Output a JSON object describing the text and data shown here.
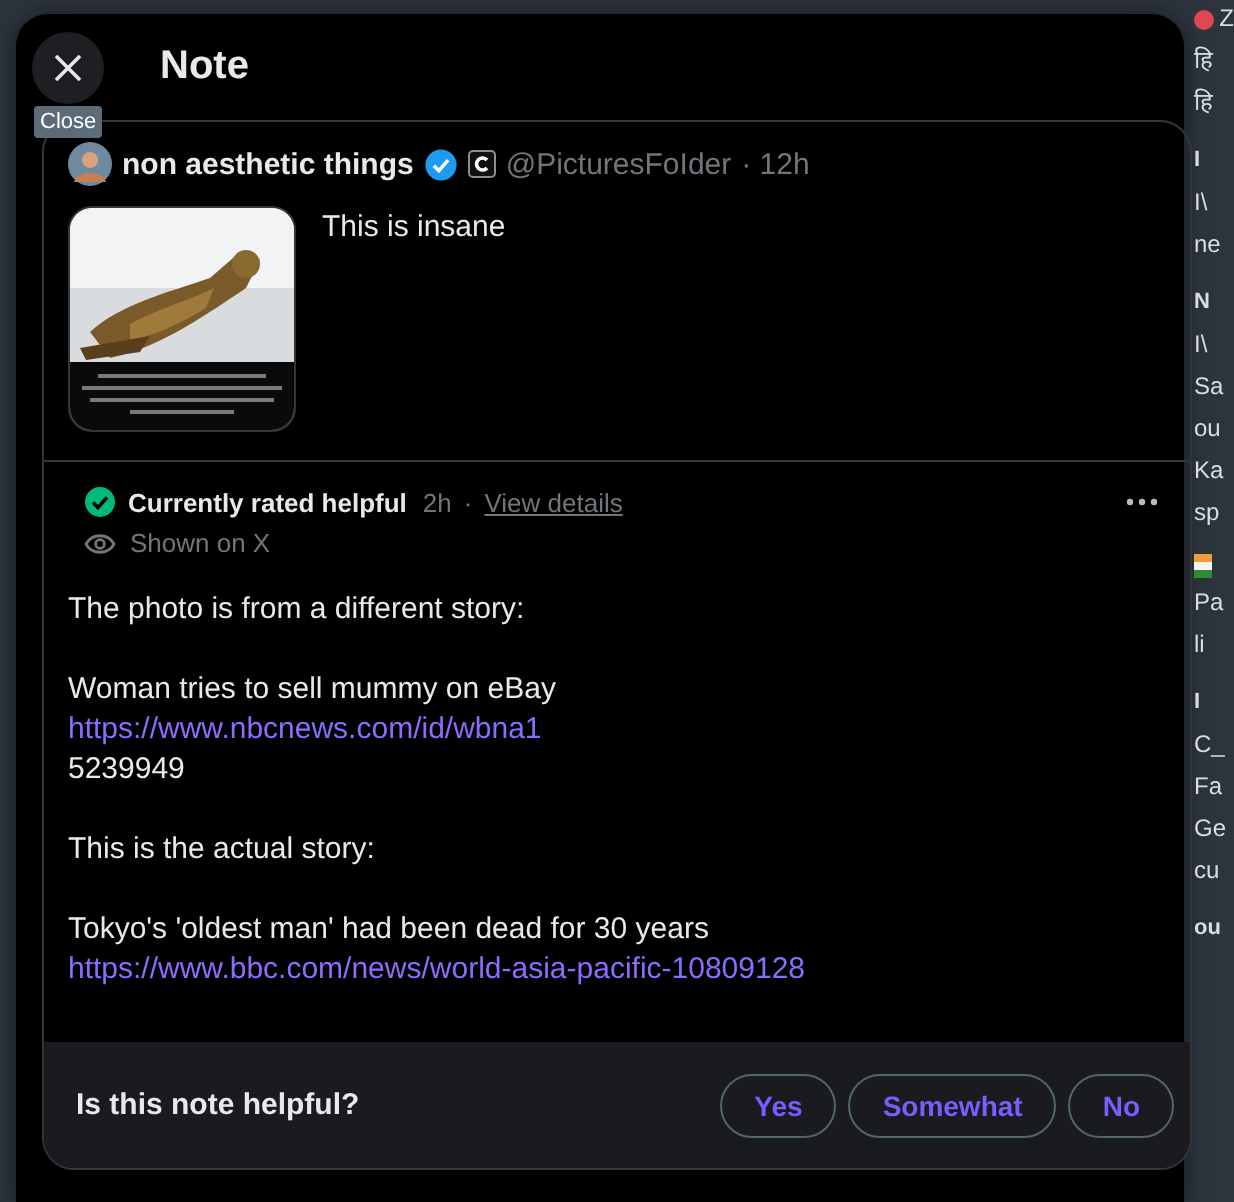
{
  "dialog": {
    "title": "Note",
    "close_tooltip": "Close"
  },
  "post": {
    "author": "non aesthetic things",
    "handle": "@PicturesFoIder",
    "time": "· 12h",
    "text": "This is insane"
  },
  "note": {
    "status": "Currently rated helpful",
    "age": "2h",
    "separator": "·",
    "details_link": "View details",
    "visibility": "Shown on X",
    "paragraphs": [
      [
        {
          "kind": "text",
          "text": "The photo is from a different story:"
        }
      ],
      [
        {
          "kind": "text",
          "text": "Woman tries to sell mummy on eBay"
        },
        {
          "kind": "link",
          "text": "https://www.nbcnews.com/id/wbna1"
        },
        {
          "kind": "text",
          "text": "5239949"
        }
      ],
      [
        {
          "kind": "text",
          "text": "This is the actual story:"
        }
      ],
      [
        {
          "kind": "text",
          "text": "Tokyo's 'oldest man' had been dead for 30 years"
        },
        {
          "kind": "link",
          "text": "https://www.bbc.com/news/world-asia-pacific-10809128"
        }
      ]
    ]
  },
  "rating": {
    "question": "Is this note helpful?",
    "options": [
      {
        "label": "Yes"
      },
      {
        "label": "Somewhat"
      },
      {
        "label": "No"
      }
    ]
  },
  "background_fragments": [
    {
      "kind": "avatar",
      "text": "Z"
    },
    {
      "kind": "line",
      "text": "हि"
    },
    {
      "kind": "line",
      "text": "हि"
    },
    {
      "kind": "heading",
      "text": "I"
    },
    {
      "kind": "line",
      "text": "I\\"
    },
    {
      "kind": "line",
      "text": "ne"
    },
    {
      "kind": "heading",
      "text": "N"
    },
    {
      "kind": "line",
      "text": "I\\"
    },
    {
      "kind": "line",
      "text": "Sa"
    },
    {
      "kind": "line",
      "text": "ou"
    },
    {
      "kind": "line",
      "text": "Ka"
    },
    {
      "kind": "line",
      "text": "sp"
    },
    {
      "kind": "flag"
    },
    {
      "kind": "line",
      "text": "Pa"
    },
    {
      "kind": "line",
      "text": "li"
    },
    {
      "kind": "heading",
      "text": "I"
    },
    {
      "kind": "line",
      "text": "C_"
    },
    {
      "kind": "line",
      "text": "Fa"
    },
    {
      "kind": "line",
      "text": "Ge"
    },
    {
      "kind": "line",
      "text": "cu"
    },
    {
      "kind": "heading",
      "text": "ou"
    }
  ]
}
